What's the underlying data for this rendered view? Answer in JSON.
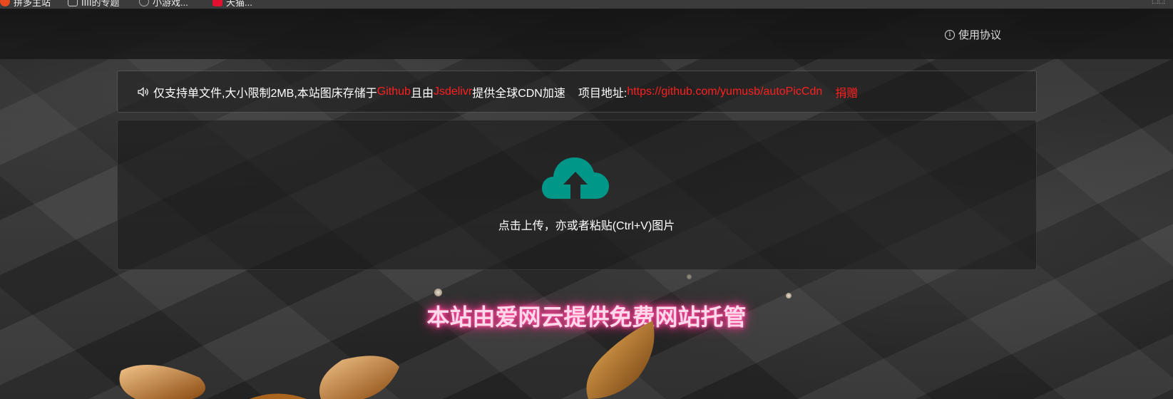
{
  "bookmarks": [
    {
      "label": "拼多主站",
      "icon": "brand-icon",
      "color": "#e84c1e"
    },
    {
      "label": "IIII的专题",
      "icon": "page-icon",
      "color": "#cccccc"
    },
    {
      "label": "小游戏...",
      "icon": "globe-icon",
      "color": "#aaaaaa"
    },
    {
      "label": "天猫...",
      "icon": "shop-icon",
      "color": "#e3102e"
    }
  ],
  "header": {
    "terms_label": "使用协议"
  },
  "notice": {
    "part1": "仅支持单文件,大小限制2MB,本站图床存储于",
    "github": "Github",
    "part2": "且由",
    "jsdelivr": "Jsdelivr",
    "part3": "提供全球CDN加速",
    "project_label": "项目地址:",
    "project_url": "https://github.com/yumusb/autoPicCdn",
    "donate": "捐赠"
  },
  "upload": {
    "hint": "点击上传，亦或者粘贴(Ctrl+V)图片",
    "icon": "cloud-upload-icon",
    "icon_color": "#009688"
  },
  "hosting": {
    "text": "本站由爱网云提供免费网站托管"
  },
  "colors": {
    "accent_red": "#ff1f1f",
    "accent_teal": "#009688",
    "glow_pink": "#ff3f95"
  }
}
